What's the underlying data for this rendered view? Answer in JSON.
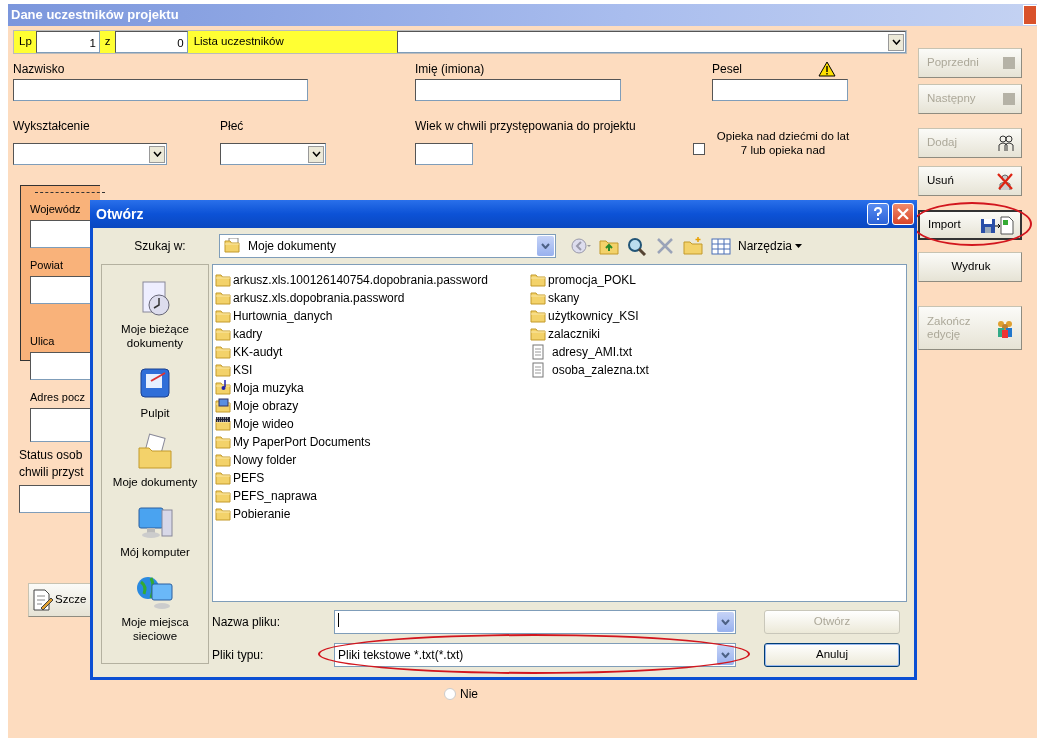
{
  "window": {
    "title": "Dane uczestników projektu"
  },
  "header_bar": {
    "lp_label": "Lp",
    "lp_value": "1",
    "of_label": "z",
    "of_value": "0",
    "list_label": "Lista uczestników"
  },
  "person": {
    "surname_label": "Nazwisko",
    "name_label": "Imię (imiona)",
    "pesel_label": "Pesel",
    "education_label": "Wykształcenie",
    "sex_label": "Płeć",
    "age_label": "Wiek w chwili przystępowania do projektu",
    "care_label": "Opieka nad dziećmi do lat 7 lub opieka nad",
    "care_checked": false
  },
  "address": {
    "labels": [
      "Wojewódz",
      "Powiat",
      "Ulica",
      "Adres pocz"
    ]
  },
  "status": {
    "label_lines": [
      "Status osob",
      "chwili przyst"
    ]
  },
  "details_button": {
    "label": "Szcze"
  },
  "radio": {
    "label": "Nie",
    "selected": false
  },
  "side_buttons": [
    {
      "label": "Poprzedni",
      "kind": "nav",
      "disabled": true,
      "focused": false,
      "circled": false
    },
    {
      "label": "Następny",
      "kind": "nav",
      "disabled": true,
      "focused": false,
      "circled": false
    },
    {
      "label": "Dodaj",
      "kind": "add",
      "disabled": true,
      "focused": false,
      "circled": false
    },
    {
      "label": "Usuń",
      "kind": "delete",
      "disabled": false,
      "focused": false,
      "circled": false
    },
    {
      "label": "Import",
      "kind": "import",
      "disabled": false,
      "focused": true,
      "circled": true
    },
    {
      "label": "Wydruk",
      "kind": "print",
      "disabled": false,
      "focused": false,
      "circled": false
    },
    {
      "label": "Zakończ edycję",
      "kind": "finish",
      "disabled": true,
      "focused": false,
      "circled": false
    }
  ],
  "dialog": {
    "title": "Otwórz",
    "look_in_label": "Szukaj w:",
    "look_in_value": "Moje dokumenty",
    "tools_label": "Narzędzia",
    "places": [
      {
        "label": "Moje bieżące dokumenty",
        "kind": "recent"
      },
      {
        "label": "Pulpit",
        "kind": "desktop"
      },
      {
        "label": "Moje dokumenty",
        "kind": "documents"
      },
      {
        "label": "Mój komputer",
        "kind": "computer"
      },
      {
        "label": "Moje miejsca sieciowe",
        "kind": "network"
      }
    ],
    "files": [
      {
        "name": "arkusz.xls.100126140754.dopobrania.password",
        "kind": "folder"
      },
      {
        "name": "arkusz.xls.dopobrania.password",
        "kind": "folder"
      },
      {
        "name": "Hurtownia_danych",
        "kind": "folder"
      },
      {
        "name": "kadry",
        "kind": "folder"
      },
      {
        "name": "KK-audyt",
        "kind": "folder"
      },
      {
        "name": "KSI",
        "kind": "folder"
      },
      {
        "name": "Moja muzyka",
        "kind": "music"
      },
      {
        "name": "Moje obrazy",
        "kind": "pictures"
      },
      {
        "name": "Moje wideo",
        "kind": "video"
      },
      {
        "name": "My PaperPort Documents",
        "kind": "folder"
      },
      {
        "name": "Nowy folder",
        "kind": "folder"
      },
      {
        "name": "PEFS",
        "kind": "folder"
      },
      {
        "name": "PEFS_naprawa",
        "kind": "folder"
      },
      {
        "name": "Pobieranie",
        "kind": "folder"
      },
      {
        "name": "promocja_POKL",
        "kind": "folder"
      },
      {
        "name": "skany",
        "kind": "folder"
      },
      {
        "name": "użytkownicy_KSI",
        "kind": "folder"
      },
      {
        "name": "zalaczniki",
        "kind": "folder"
      },
      {
        "name": "adresy_AMI.txt",
        "kind": "text"
      },
      {
        "name": "osoba_zalezna.txt",
        "kind": "text"
      }
    ],
    "file_name_label": "Nazwa pliku:",
    "file_type_label": "Pliki typu:",
    "file_type_value": "Pliki tekstowe *.txt(*.txt)",
    "file_type_circled": true,
    "buttons": [
      {
        "label": "Otwórz",
        "disabled": true
      },
      {
        "label": "Anuluj",
        "disabled": false
      }
    ]
  }
}
